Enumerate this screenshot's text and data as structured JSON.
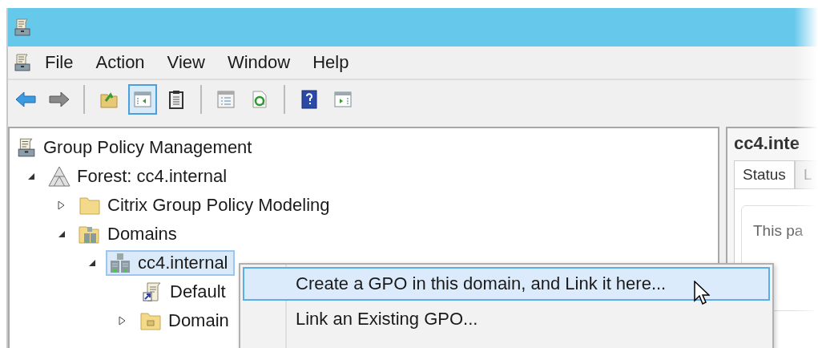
{
  "menu_bar": {
    "items": [
      "File",
      "Action",
      "View",
      "Window",
      "Help"
    ]
  },
  "toolbar": {
    "groups": [
      [
        {
          "kind": "back",
          "pressed": false
        },
        {
          "kind": "forward",
          "pressed": false
        }
      ],
      [
        {
          "kind": "up-folder",
          "pressed": false
        },
        {
          "kind": "tree-toggle",
          "pressed": true
        },
        {
          "kind": "clipboard",
          "pressed": false
        }
      ],
      [
        {
          "kind": "properties",
          "pressed": false
        },
        {
          "kind": "refresh",
          "pressed": false
        }
      ],
      [
        {
          "kind": "help",
          "pressed": false
        },
        {
          "kind": "action-pane",
          "pressed": false
        }
      ]
    ]
  },
  "tree": {
    "items": [
      {
        "label": "Group Policy Management",
        "kind": "console",
        "selected": false,
        "children": [
          {
            "label": "Forest: cc4.internal",
            "kind": "forest",
            "expanded": true,
            "selected": false,
            "children": [
              {
                "label": "Citrix Group Policy Modeling",
                "kind": "folder",
                "expanded": false,
                "selected": false
              },
              {
                "label": "Domains",
                "kind": "domains",
                "expanded": true,
                "selected": false,
                "children": [
                  {
                    "label": "cc4.internal",
                    "kind": "domain",
                    "expanded": true,
                    "selected": true,
                    "children": [
                      {
                        "label": "Default",
                        "kind": "gpo-link",
                        "selected": false
                      },
                      {
                        "label": "Domain",
                        "kind": "ou",
                        "expanded": false,
                        "selected": false
                      }
                    ]
                  }
                ]
              }
            ]
          }
        ]
      }
    ]
  },
  "context_menu": {
    "items": [
      {
        "label": "Create a GPO in this domain, and Link it here...",
        "selected": true
      },
      {
        "label": "Link an Existing GPO...",
        "selected": false
      }
    ]
  },
  "details_pane": {
    "title": "cc4.inte",
    "tabs": [
      {
        "label": "Status",
        "selected": true
      },
      {
        "label": "L",
        "selected": false
      }
    ],
    "body_text": "This pa"
  }
}
